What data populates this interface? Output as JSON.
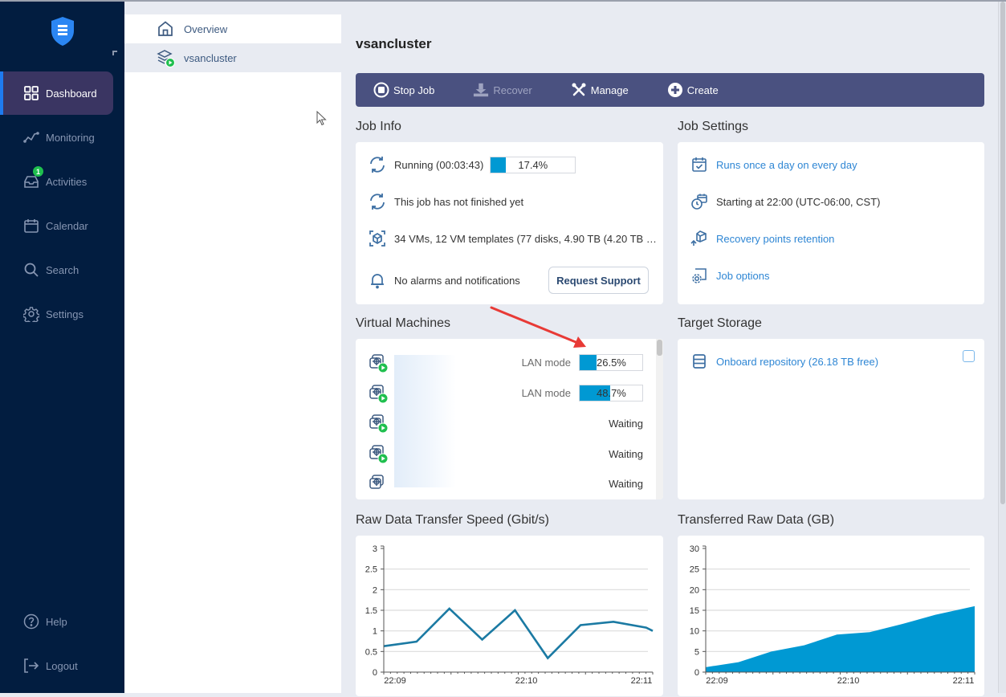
{
  "sidebar": {
    "logo": "shield-logo",
    "items": [
      {
        "label": "Dashboard",
        "icon": "grid-icon",
        "active": true
      },
      {
        "label": "Monitoring",
        "icon": "chart-line-icon"
      },
      {
        "label": "Activities",
        "icon": "inbox-icon",
        "badge": "1"
      },
      {
        "label": "Calendar",
        "icon": "calendar-icon"
      },
      {
        "label": "Search",
        "icon": "search-icon"
      },
      {
        "label": "Settings",
        "icon": "gear-icon"
      }
    ],
    "bottom": [
      {
        "label": "Help",
        "icon": "help-icon"
      },
      {
        "label": "Logout",
        "icon": "logout-icon"
      }
    ]
  },
  "tree": {
    "items": [
      {
        "label": "Overview",
        "icon": "home-icon"
      },
      {
        "label": "vsancluster",
        "icon": "cluster-running-icon",
        "selected": true
      }
    ]
  },
  "main": {
    "title": "vsancluster",
    "toolbar": {
      "stop_job": "Stop Job",
      "recover": "Recover",
      "manage": "Manage",
      "create": "Create"
    },
    "job_info": {
      "title": "Job Info",
      "running": "Running (00:03:43)",
      "progress_pct": 17.4,
      "progress_label": "17.4%",
      "not_finished": "This job has not finished yet",
      "summary": "34 VMs, 12 VM templates (77 disks, 4.90 TB (4.20 TB …",
      "alarms": "No alarms and notifications",
      "request_support": "Request Support"
    },
    "job_settings": {
      "title": "Job Settings",
      "schedule": "Runs once a day on every day",
      "start": "Starting at 22:00 (UTC-06:00, CST)",
      "retention": "Recovery points retention",
      "options": "Job options"
    },
    "vms": {
      "title": "Virtual Machines",
      "rows": [
        {
          "mode": "LAN mode",
          "progress_pct": 26.5,
          "progress_label": "26.5%",
          "running": true
        },
        {
          "mode": "LAN mode",
          "progress_pct": 48.7,
          "progress_label": "48.7%",
          "running": true
        },
        {
          "status": "Waiting",
          "running": true
        },
        {
          "status": "Waiting",
          "running": true
        },
        {
          "status": "Waiting",
          "running": false
        }
      ]
    },
    "target_storage": {
      "title": "Target Storage",
      "repository": "Onboard repository (26.18 TB free)"
    },
    "speed_chart_title": "Raw Data Transfer Speed (Gbit/s)",
    "data_chart_title": "Transferred Raw Data (GB)"
  },
  "chart_data": [
    {
      "type": "line",
      "title": "Raw Data Transfer Speed (Gbit/s)",
      "xlabel": "",
      "ylabel": "",
      "x_tick_labels": [
        "22:09",
        "22:10",
        "22:11"
      ],
      "y_ticks": [
        0,
        0.5,
        1,
        1.5,
        2,
        2.5,
        3
      ],
      "y_tick_labels": [
        "0",
        "0.5",
        "1",
        "1.5",
        "2",
        "2.5",
        "3"
      ],
      "ylim": [
        0,
        3
      ],
      "grid": true,
      "color": "#1b7aa3",
      "x": [
        0,
        1,
        2,
        3,
        4,
        5,
        6,
        7,
        8,
        8.2
      ],
      "values": [
        0.63,
        0.74,
        1.54,
        0.79,
        1.5,
        0.34,
        1.14,
        1.22,
        1.08,
        1.0
      ]
    },
    {
      "type": "area",
      "title": "Transferred Raw Data (GB)",
      "xlabel": "",
      "ylabel": "",
      "x_tick_labels": [
        "22:09",
        "22:10",
        "22:11"
      ],
      "y_ticks": [
        0,
        5,
        10,
        15,
        20,
        25,
        30
      ],
      "y_tick_labels": [
        "0",
        "5",
        "10",
        "15",
        "20",
        "25",
        "30"
      ],
      "ylim": [
        0,
        30
      ],
      "grid": true,
      "color": "#0099d3",
      "x": [
        0,
        1,
        2,
        3,
        4,
        5,
        6,
        7,
        8.2
      ],
      "values": [
        1.2,
        2.4,
        5.0,
        6.5,
        9.1,
        9.7,
        11.7,
        13.9,
        16.0
      ]
    }
  ]
}
